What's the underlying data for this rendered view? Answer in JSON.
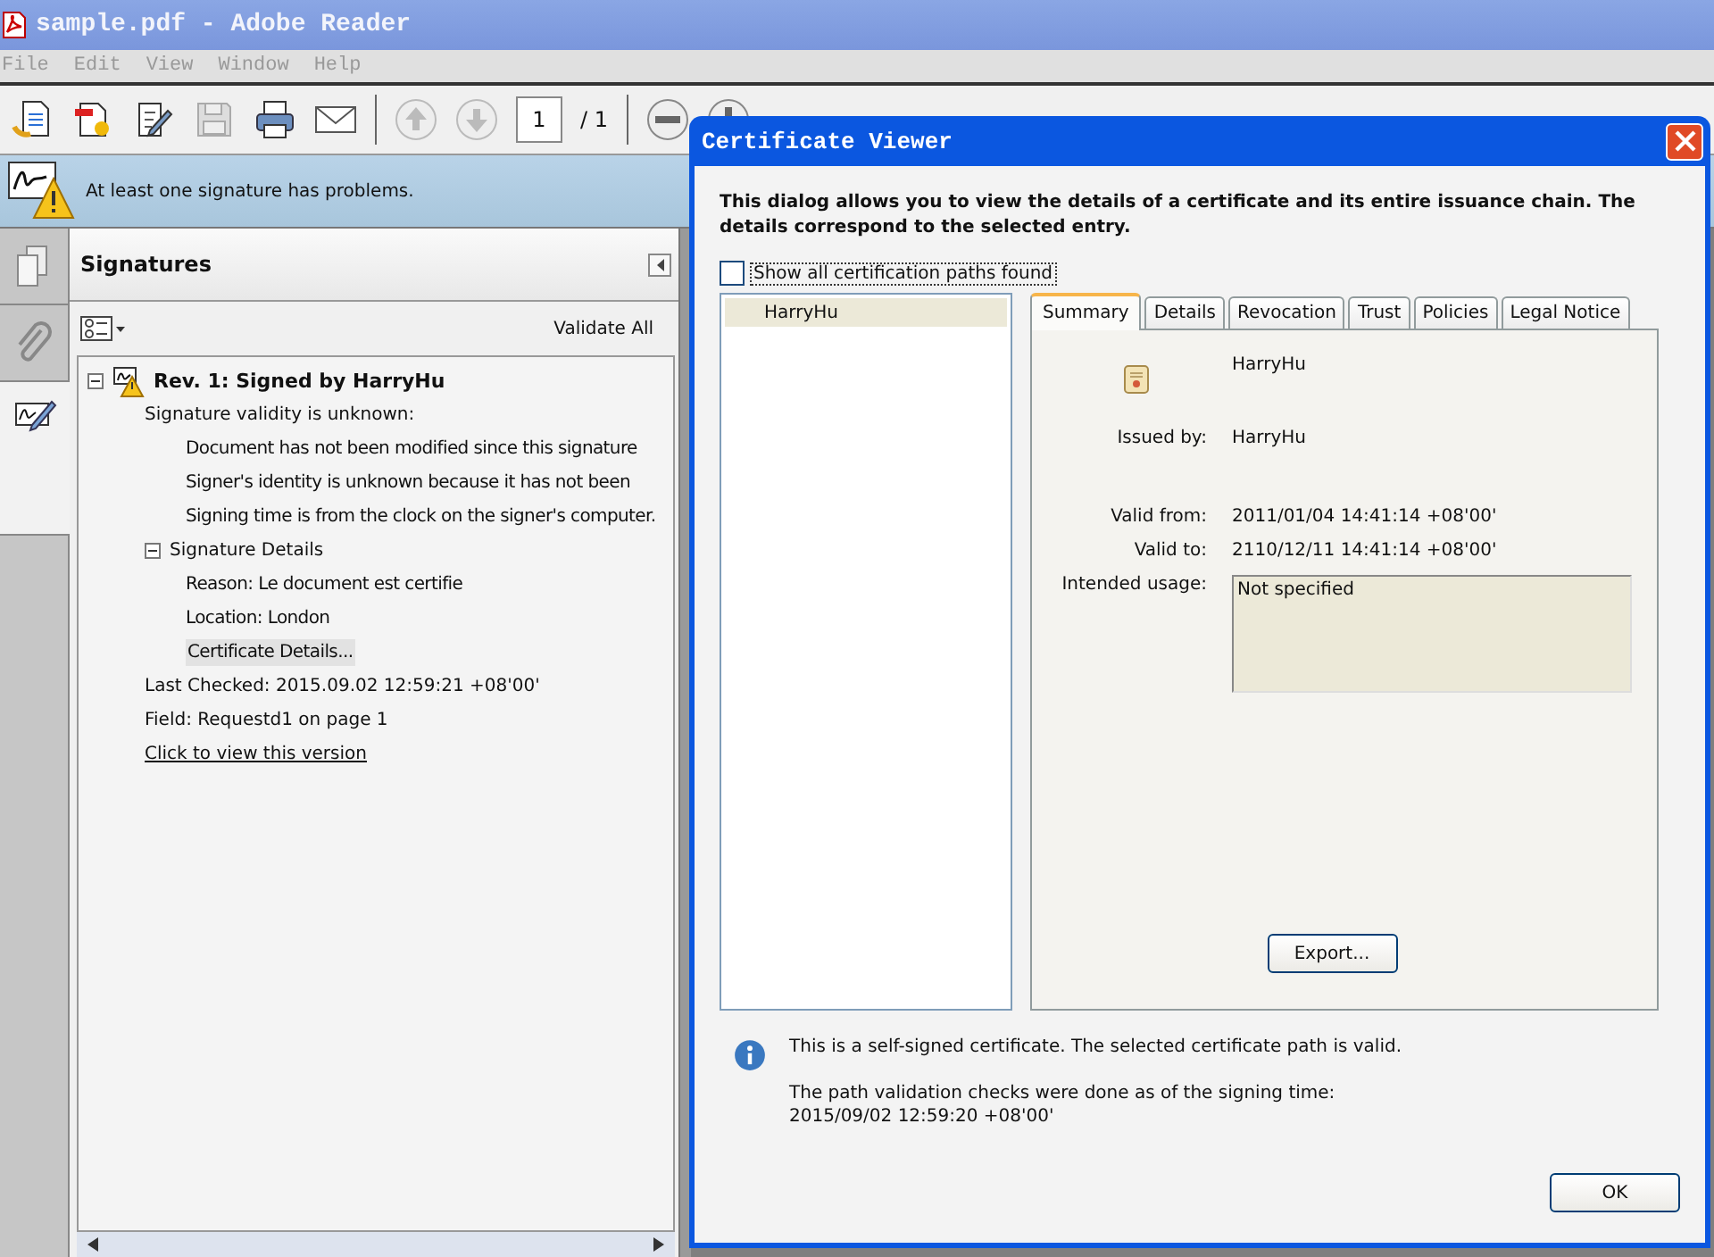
{
  "window": {
    "title": "sample.pdf - Adobe Reader"
  },
  "menu": [
    {
      "label": "File"
    },
    {
      "label": "Edit"
    },
    {
      "label": "View"
    },
    {
      "label": "Window"
    },
    {
      "label": "Help"
    }
  ],
  "toolbar": {
    "page_field": "1",
    "page_total": "/ 1"
  },
  "notice": {
    "text": "At least one signature has problems."
  },
  "rail_tabs": [
    {
      "kind": "pages",
      "selected": false
    },
    {
      "kind": "attachments",
      "selected": false
    },
    {
      "kind": "signatures",
      "selected": true
    }
  ],
  "signatures_panel": {
    "title": "Signatures",
    "validate_all": "Validate All",
    "tree": [
      {
        "kind": "signature",
        "label": "Rev. 1: Signed by HarryHu",
        "expanded": true,
        "selected": false,
        "children": [
          {
            "kind": "text",
            "label": "Signature validity is unknown:",
            "selected": false,
            "children": [
              {
                "kind": "text",
                "label": "Document has not been modified since this signature",
                "selected": false
              },
              {
                "kind": "text",
                "label": "Signer's identity is unknown because it has not been",
                "selected": false
              },
              {
                "kind": "text",
                "label": "Signing time is from the clock on the signer's computer.",
                "selected": false
              }
            ]
          },
          {
            "kind": "node",
            "label": "Signature Details",
            "expanded": true,
            "selected": false,
            "children": [
              {
                "kind": "text",
                "label": "Reason: Le document est certifie",
                "selected": false
              },
              {
                "kind": "text",
                "label": "Location: London",
                "selected": false
              },
              {
                "kind": "text",
                "label": "Certificate Details...",
                "selected": true
              }
            ]
          },
          {
            "kind": "text",
            "label": "Last Checked: 2015.09.02 12:59:21 +08'00'",
            "selected": false
          },
          {
            "kind": "text",
            "label": "Field: Requestd1 on page 1",
            "selected": false
          },
          {
            "kind": "link",
            "label": "Click to view this version",
            "selected": false
          }
        ]
      }
    ]
  },
  "dialog": {
    "title": "Certificate Viewer",
    "intro": "This dialog allows you to view the details of a certificate and its entire issuance chain. The details correspond to the selected entry.",
    "show_all_paths": {
      "label": "Show all certification paths found",
      "checked": false
    },
    "chain": [
      {
        "label": "HarryHu",
        "selected": true
      }
    ],
    "tabs": [
      {
        "label": "Summary",
        "selected": true
      },
      {
        "label": "Details",
        "selected": false
      },
      {
        "label": "Revocation",
        "selected": false
      },
      {
        "label": "Trust",
        "selected": false
      },
      {
        "label": "Policies",
        "selected": false
      },
      {
        "label": "Legal Notice",
        "selected": false
      }
    ],
    "summary": {
      "subject": "HarryHu",
      "fields": [
        {
          "label": "Issued by:",
          "value": "HarryHu"
        },
        {
          "label": "Valid from:",
          "value": "2011/01/04 14:41:14 +08'00'"
        },
        {
          "label": "Valid to:",
          "value": "2110/12/11 14:41:14 +08'00'"
        }
      ],
      "intended_usage": {
        "label": "Intended usage:",
        "value": "Not specified"
      },
      "export_button": "Export..."
    },
    "message": "This is a self-signed certificate. The selected certificate path is valid.",
    "note_lines": [
      "The path validation checks were done as of the signing time:",
      "2015/09/02 12:59:20 +08'00'"
    ],
    "ok_button": "OK"
  }
}
